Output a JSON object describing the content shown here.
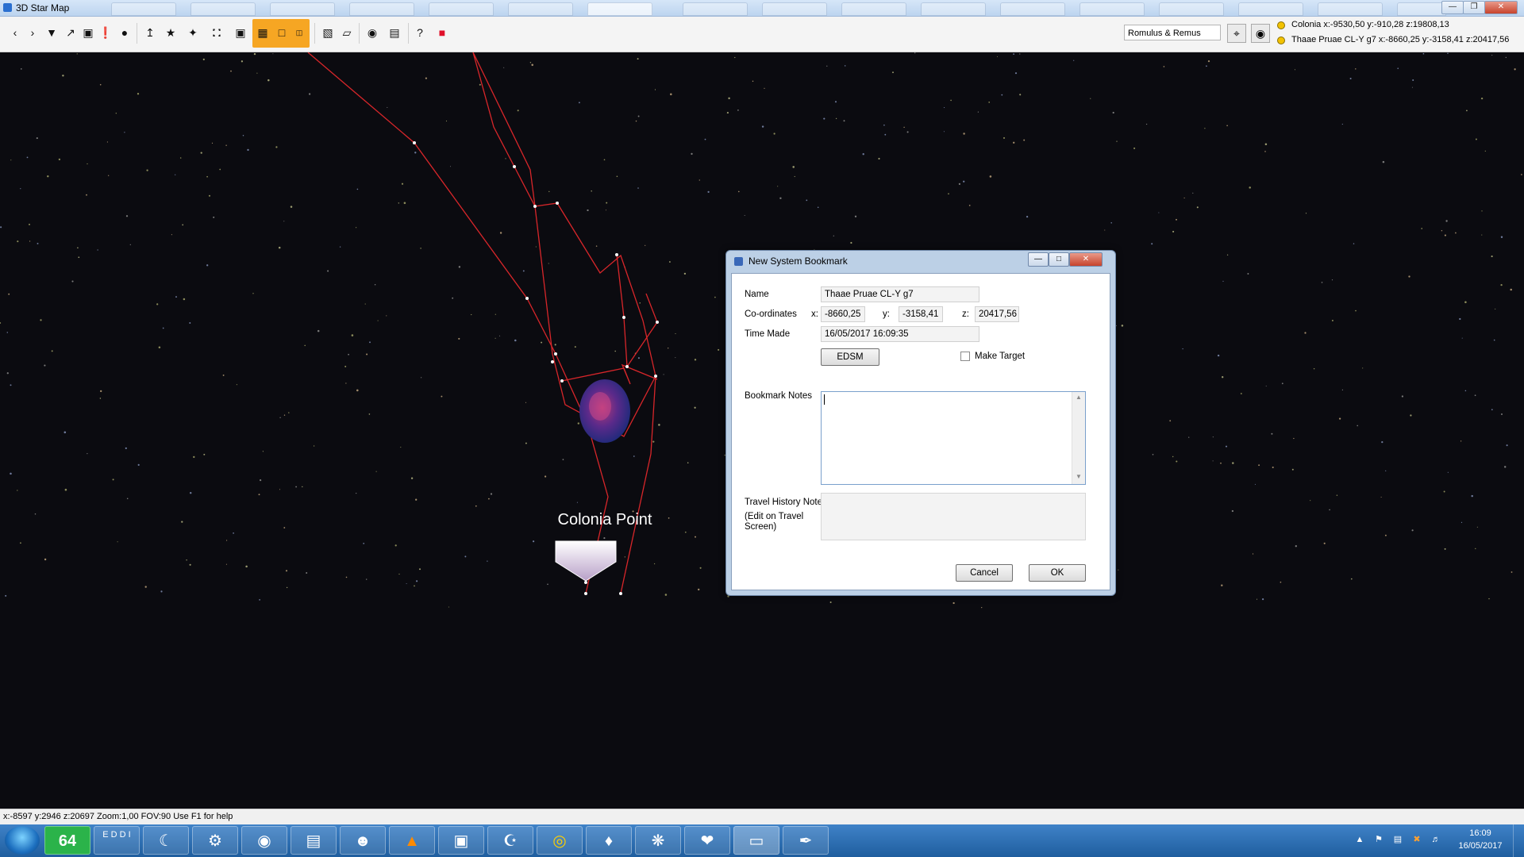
{
  "window": {
    "title": "3D Star Map"
  },
  "toolbar": {
    "target_input": "Romulus & Remus",
    "positions": [
      {
        "text": "Colonia x:-9530,50 y:-910,28 z:19808,13"
      },
      {
        "text": "Thaae Pruae CL-Y g7 x:-8660,25 y:-3158,41 z:20417,56"
      }
    ],
    "help_label": "?"
  },
  "map": {
    "marker_label": "Colonia Point"
  },
  "dialog": {
    "title": "New System Bookmark",
    "name_label": "Name",
    "name_value": "Thaae Pruae CL-Y g7",
    "coords_label": "Co-ordinates",
    "x_label": "x:",
    "x_value": "-8660,25",
    "y_label": "y:",
    "y_value": "-3158,41",
    "z_label": "z:",
    "z_value": "20417,56",
    "time_label": "Time Made",
    "time_value": "16/05/2017 16:09:35",
    "edsm_button": "EDSM",
    "make_target_label": "Make Target",
    "notes_label": "Bookmark Notes",
    "travel_label": "Travel History Note",
    "travel_sublabel": "(Edit on Travel Screen)",
    "cancel_button": "Cancel",
    "ok_button": "OK"
  },
  "status": {
    "text": "x:-8597  y:2946   z:20697  Zoom:1,00 FOV:90   Use F1 for help"
  },
  "taskbar": {
    "badge_64": "64",
    "edd_label": "E D D I",
    "clock_time": "16:09",
    "clock_date": "16/05/2017"
  }
}
